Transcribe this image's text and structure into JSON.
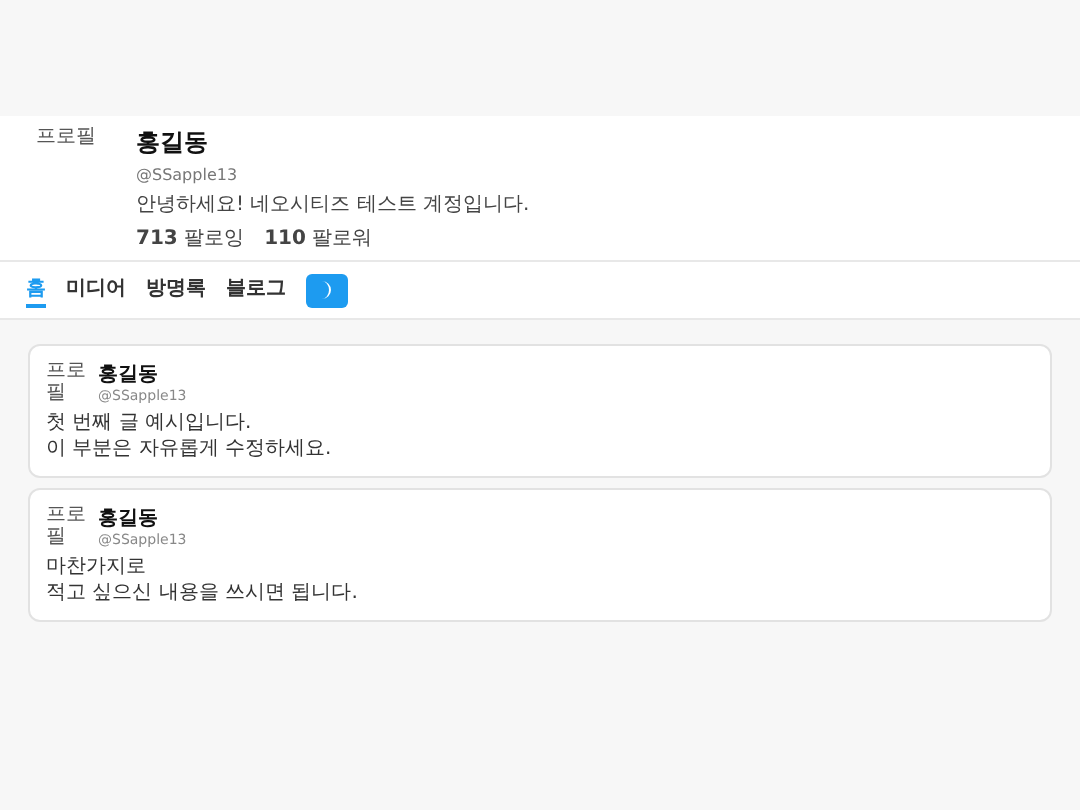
{
  "profile": {
    "avatar_alt": "프로필",
    "name": "홍길동",
    "handle": "@SSapple13",
    "bio": "안녕하세요! 네오시티즈 테스트 계정입니다.",
    "stats": [
      {
        "count": "713",
        "label": "팔로잉"
      },
      {
        "count": "110",
        "label": "팔로워"
      }
    ]
  },
  "tabs": [
    {
      "label": "홈",
      "selected": true
    },
    {
      "label": "미디어",
      "selected": false
    },
    {
      "label": "방명록",
      "selected": false
    },
    {
      "label": "블로그",
      "selected": false
    }
  ],
  "posts": [
    {
      "avatar_alt": "프로필",
      "name": "홍길동",
      "handle": "@SSapple13",
      "lines": [
        "첫 번째 글 예시입니다.",
        "이 부분은 자유롭게 수정하세요."
      ]
    },
    {
      "avatar_alt": "프로필",
      "name": "홍길동",
      "handle": "@SSapple13",
      "lines": [
        "마찬가지로",
        "적고 싶으신 내용을 쓰시면 됩니다."
      ]
    }
  ]
}
